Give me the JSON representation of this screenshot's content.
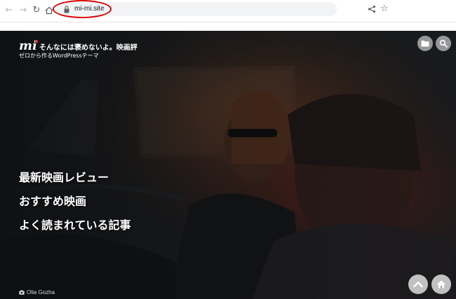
{
  "browser": {
    "url": "mi-mi.site",
    "icons": {
      "back": "back-arrow-icon",
      "forward": "forward-arrow-icon",
      "reload": "reload-icon",
      "home": "home-icon",
      "lock": "lock-icon",
      "share": "share-icon",
      "bookmark": "star-icon"
    },
    "highlight_color": "#d90000"
  },
  "site": {
    "logo_mark": "mi",
    "title": "そんなには褒めないよ。映画評",
    "tagline": "ゼロから作るWordPressテーマ"
  },
  "hero": {
    "menu": [
      {
        "label": "最新映画レビュー"
      },
      {
        "label": "おすすめ映画"
      },
      {
        "label": "よく読まれている記事"
      }
    ],
    "photo_credit": "Olia Gozha"
  },
  "header_buttons": {
    "categories": "folder-icon",
    "search": "search-icon"
  },
  "footer_buttons": {
    "scroll_top": "chevron-up-icon",
    "home": "home-icon"
  }
}
